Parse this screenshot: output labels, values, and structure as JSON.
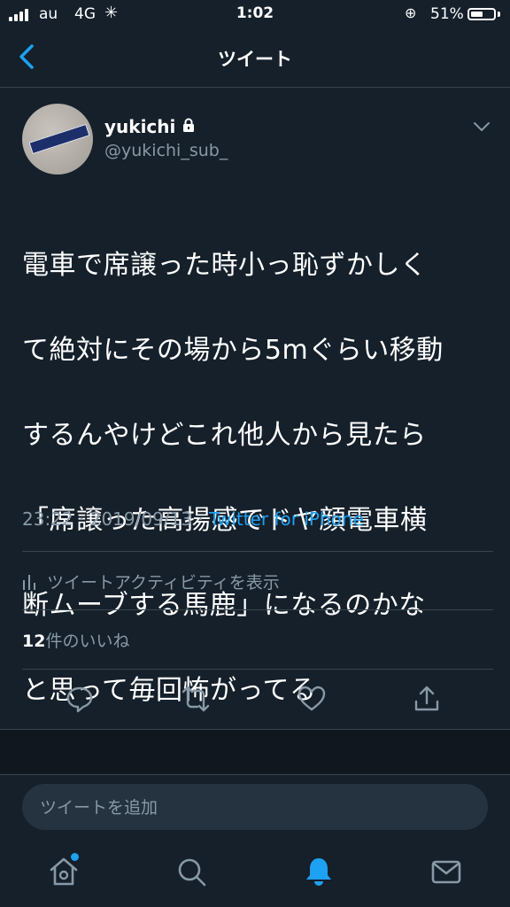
{
  "status": {
    "carrier": "au",
    "network": "4G",
    "time": "1:02",
    "battery": "51%",
    "battery_level": 0.51
  },
  "header": {
    "title": "ツイート"
  },
  "tweet": {
    "name": "yukichi",
    "handle": "@yukichi_sub_",
    "text": "電車で席譲った時小っ恥ずかしくて絶対にその場から5mぐらい移動するんやけどこれ他人から見たら「席譲った高揚感でドヤ顔電車横断ムーブする馬鹿」になるのかなと思って毎回怖がってる",
    "text_lines": [
      "電車で席譲った時小っ恥ずかしく",
      "て絶対にその場から5mぐらい移動",
      "するんやけどこれ他人から見たら",
      "「席譲った高揚感でドヤ顔電車横",
      "断ムーブする馬鹿」になるのかな",
      "と思って毎回怖がってる"
    ],
    "time": "23:22",
    "date": "2019/09/13",
    "separator": "·",
    "source": "Twitter for iPhone",
    "activity": "ツイートアクティビティを表示",
    "like_count": "12",
    "like_label": "件のいいね"
  },
  "reply": {
    "placeholder": "ツイートを追加"
  },
  "icons": {
    "back": "chevron-left-icon",
    "reply": "reply-icon",
    "retweet": "retweet-icon",
    "like": "heart-icon",
    "share": "share-icon",
    "home": "home-icon",
    "search": "search-icon",
    "notifications": "bell-icon",
    "messages": "mail-icon"
  },
  "colors": {
    "background": "#15202b",
    "accent": "#1da1f2",
    "muted": "#8899a6",
    "divider": "#38444d"
  }
}
